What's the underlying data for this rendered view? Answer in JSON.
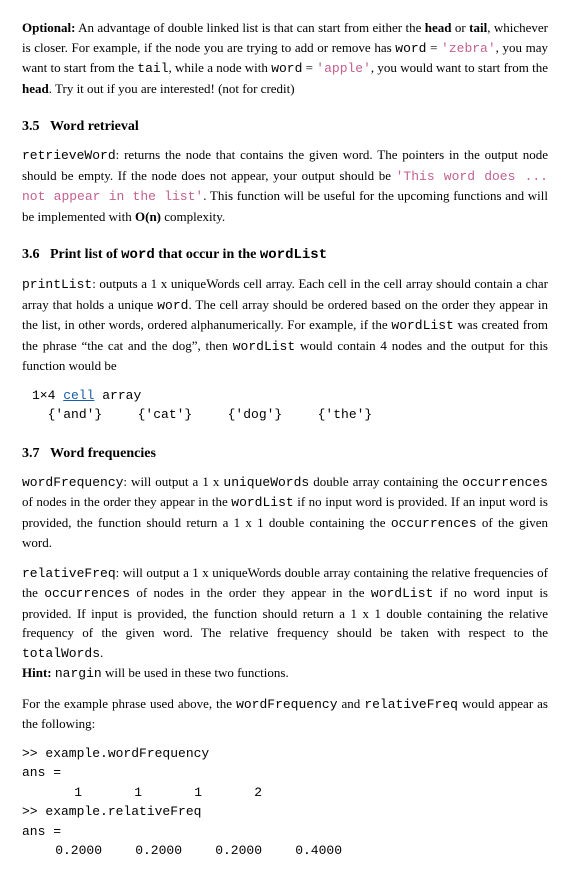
{
  "optional": {
    "label": "Optional:",
    "text1": " An advantage of double linked list is that can start from either the ",
    "head": "head",
    "text2": " or ",
    "tail": "tail",
    "text3": ", whichever is closer. For example, if the node you are trying to add or remove has ",
    "wordvar": "word",
    "eq": " = ",
    "zebra": "'zebra'",
    "text4": ", you may want to start from the ",
    "tail2": "tail",
    "text5": ", while a node with ",
    "wordvar2": "word",
    "apple": "'apple'",
    "text6": ", you would want to start from the ",
    "head2": "head",
    "text7": ". Try it out if you are interested! (not for credit)"
  },
  "s35": {
    "num": "3.5",
    "title": "Word retrieval",
    "fn": "retrieveWord",
    "text1": ": returns the node that contains the given word. The pointers in the output node should be empty. If the node does not appear, your output should be ",
    "msg": "'This word does ... not appear in the list'",
    "text2": ". This function will be useful for the upcoming functions and will be implemented with ",
    "bigO": "O(n)",
    "text3": " complexity."
  },
  "s36": {
    "num": "3.6",
    "title_a": "Print list of ",
    "word": "word",
    "title_b": " that occur in the ",
    "wordlist": "wordList",
    "fn": "printList",
    "text1": ": outputs a 1 x uniqueWords cell array. Each cell in the cell array should contain a char array that holds a unique ",
    "text2": ". The cell array should be ordered based on the order they appear in the list, in other words, ordered alphanumerically. For example, if the ",
    "text3": " was created from the phrase “the cat and the dog”, then ",
    "text4": " would contain 4 nodes and the output for this function would be",
    "arr_dim": "1×4 ",
    "cell": "cell",
    "arr_suffix": " array",
    "cells": [
      "{'and'}",
      "{'cat'}",
      "{'dog'}",
      "{'the'}"
    ]
  },
  "s37": {
    "num": "3.7",
    "title": "Word frequencies",
    "fn1": "wordFrequency",
    "t1a": ": will output a 1 x ",
    "uniqueWords": "uniqueWords",
    "t1b": " double array containing the ",
    "occ": "occurrences",
    "t1c": " of nodes in the order they appear in the ",
    "wordList": "wordList",
    "t1d": " if no input word is provided. If an input word is provided, the function should return a 1 x 1 double containing the ",
    "t1e": " of the given word.",
    "fn2": "relativeFreq",
    "t2a": ": will output a 1 x uniqueWords double array containing the relative frequencies of the ",
    "t2b": " of nodes in the order they appear in the ",
    "t2c": " if no word input is provided. If input is provided, the function should return a 1 x 1 double containing the relative frequency of the given word. The relative frequency should be taken with respect to the ",
    "totalWords": "totalWords",
    "t2d": ".",
    "hint_label": "Hint:",
    "nargin": "nargin",
    "hint_text": " will be used in these two functions.",
    "example_intro_a": "For the example phrase used above, the ",
    "example_intro_b": " and ",
    "example_intro_c": " would appear as the following:",
    "cmd1": ">> example.wordFrequency",
    "ans": "ans =",
    "freq_vals": [
      "1",
      "1",
      "1",
      "2"
    ],
    "cmd2": ">> example.relativeFreq",
    "rel_vals": [
      "0.2000",
      "0.2000",
      "0.2000",
      "0.4000"
    ]
  },
  "chart_data": {
    "type": "table",
    "title": "wordFrequency and relativeFreq output",
    "categories": [
      "and",
      "cat",
      "dog",
      "the"
    ],
    "series": [
      {
        "name": "wordFrequency",
        "values": [
          1,
          1,
          1,
          2
        ]
      },
      {
        "name": "relativeFreq",
        "values": [
          0.2,
          0.2,
          0.2,
          0.4
        ]
      }
    ]
  }
}
